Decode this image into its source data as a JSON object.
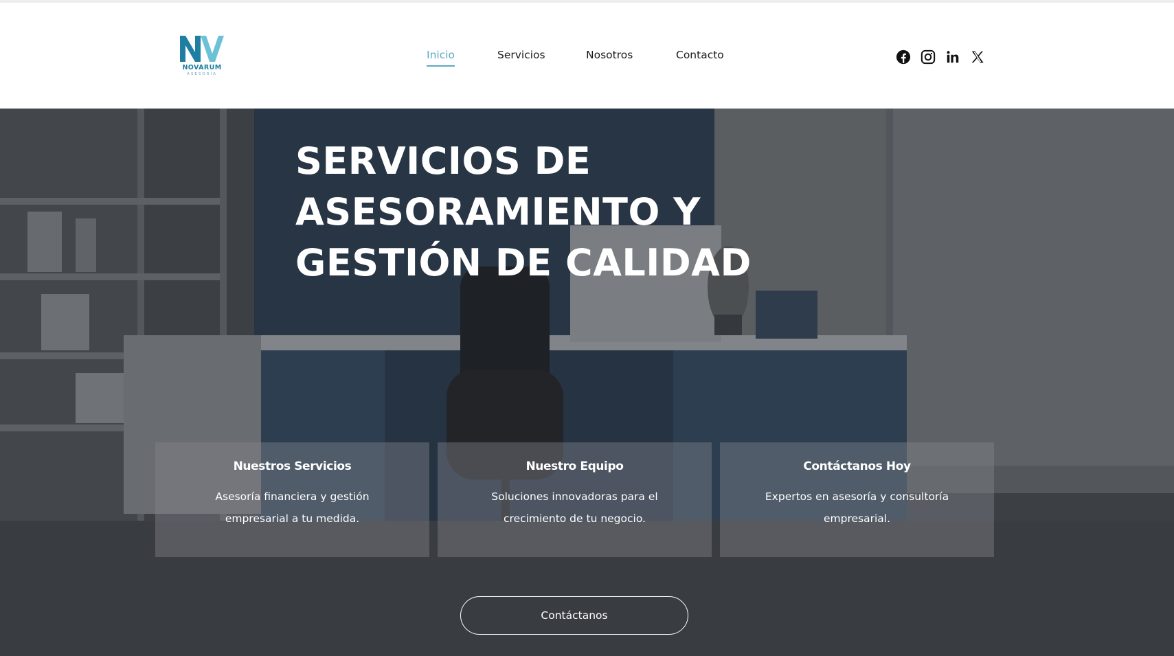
{
  "brand": {
    "name": "NOVARUM",
    "tagline": "ASESORÍA",
    "colors": {
      "accent": "#5aa9c4",
      "logo_dark": "#1f7fa3",
      "logo_light": "#6cc1d6"
    }
  },
  "nav": {
    "items": [
      {
        "label": "Inicio",
        "active": true
      },
      {
        "label": "Servicios",
        "active": false
      },
      {
        "label": "Nosotros",
        "active": false
      },
      {
        "label": "Contacto",
        "active": false
      }
    ]
  },
  "social": {
    "icons": [
      "facebook-icon",
      "instagram-icon",
      "linkedin-icon",
      "x-icon"
    ]
  },
  "hero": {
    "title_lines": [
      "SERVICIOS DE",
      "ASESORAMIENTO Y",
      "GESTIÓN DE CALIDAD"
    ],
    "cards": [
      {
        "title": "Nuestros Servicios",
        "text": "Asesoría financiera y gestión empresarial a tu medida."
      },
      {
        "title": "Nuestro Equipo",
        "text": "Soluciones innovadoras para el crecimiento de tu negocio."
      },
      {
        "title": "Contáctanos Hoy",
        "text": "Expertos en asesoría y consultoría empresarial."
      }
    ],
    "cta_label": "Contáctanos"
  }
}
